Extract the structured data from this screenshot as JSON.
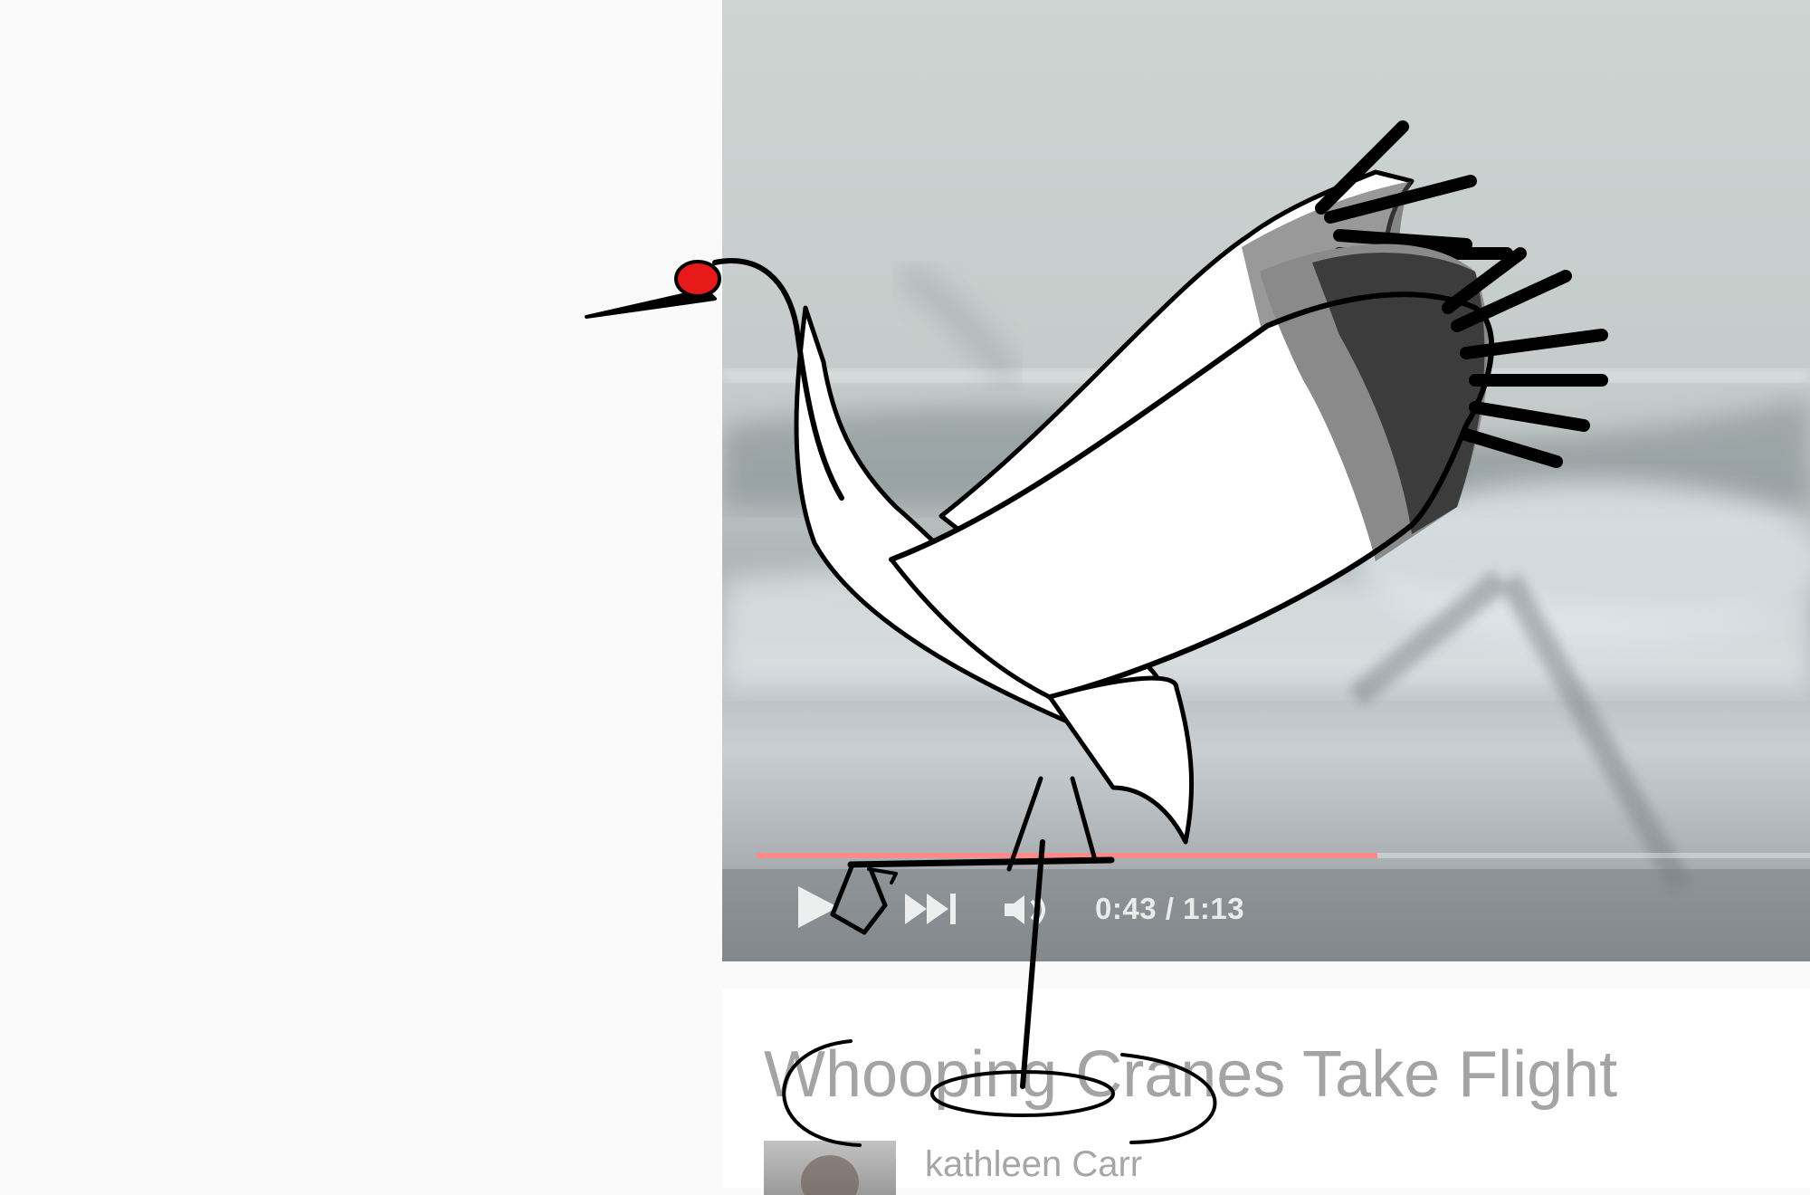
{
  "player": {
    "current_time": "0:43",
    "time_separator": " / ",
    "duration": "1:13",
    "progress_fraction": 0.589,
    "progress_color": "#ff8a8a",
    "controls": {
      "play_icon": "play-icon",
      "next_icon": "skip-next-icon",
      "volume_icon": "volume-icon"
    }
  },
  "video_info": {
    "title": "Whooping Cranes Take Flight",
    "channel_name": "kathleen Carr"
  },
  "overlay": {
    "illustration": "crane-illustration",
    "crown_color": "#e81919"
  }
}
